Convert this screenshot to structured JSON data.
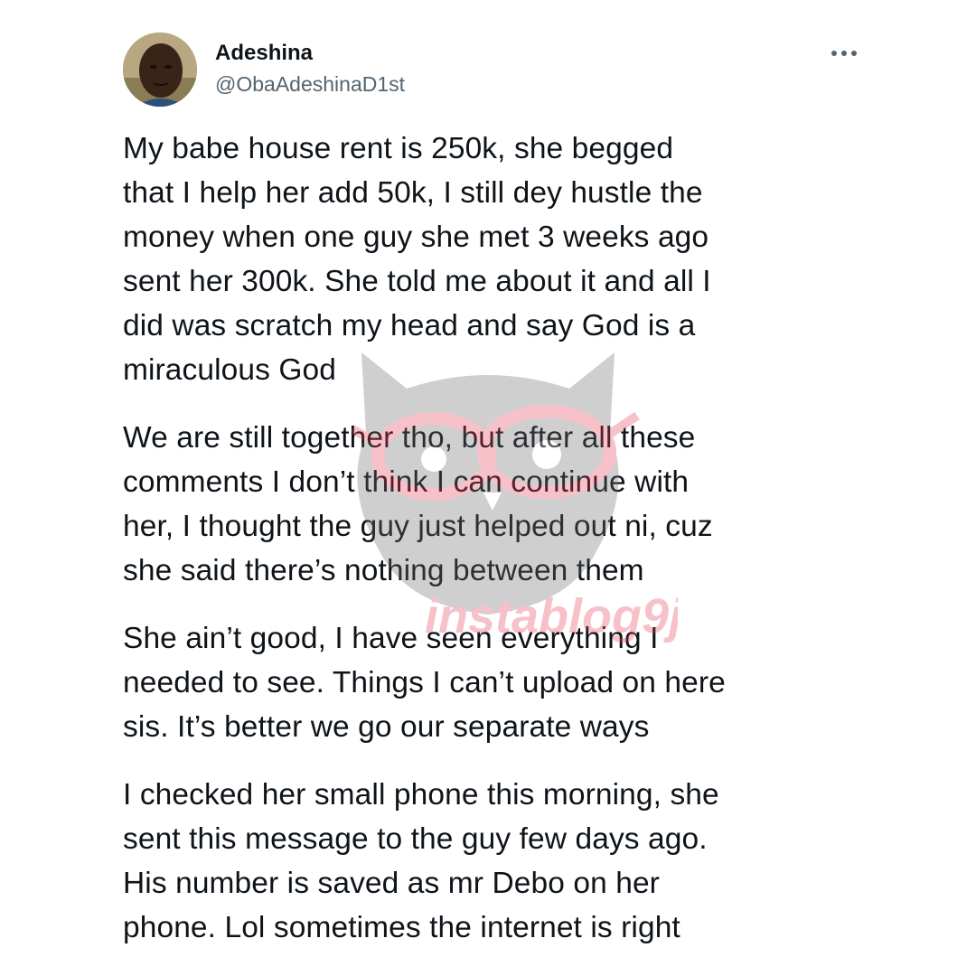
{
  "tweet": {
    "author": {
      "display_name": "Adeshina",
      "handle": "@ObaAdeshinaD1st"
    },
    "paragraphs": [
      "My babe house rent is 250k, she begged\nthat I help her add 50k, I still dey hustle the\nmoney when one guy she met 3 weeks ago\nsent her 300k. She told me about it and all I\ndid was scratch my head and say God is a\nmiraculous God",
      "We are still together tho, but after all these\ncomments I don’t think I can continue with\nher, I thought the guy just helped out ni, cuz\nshe said there’s nothing between them",
      "She ain’t good, I have seen everything I\nneeded to see. Things I can’t upload on here\nsis. It’s better we go our separate ways",
      "I checked her small phone this morning, she\nsent this message to the guy few days ago.\nHis number is saved as mr Debo on her\nphone. Lol sometimes the internet is right"
    ]
  },
  "watermark": {
    "text": "instablog9ja"
  },
  "colors": {
    "text": "#0f1419",
    "handle": "#536471",
    "watermark_gray": "#6b6b6b",
    "watermark_pink": "#e8415b"
  },
  "icons": {
    "more": "more-horizontal-icon"
  }
}
